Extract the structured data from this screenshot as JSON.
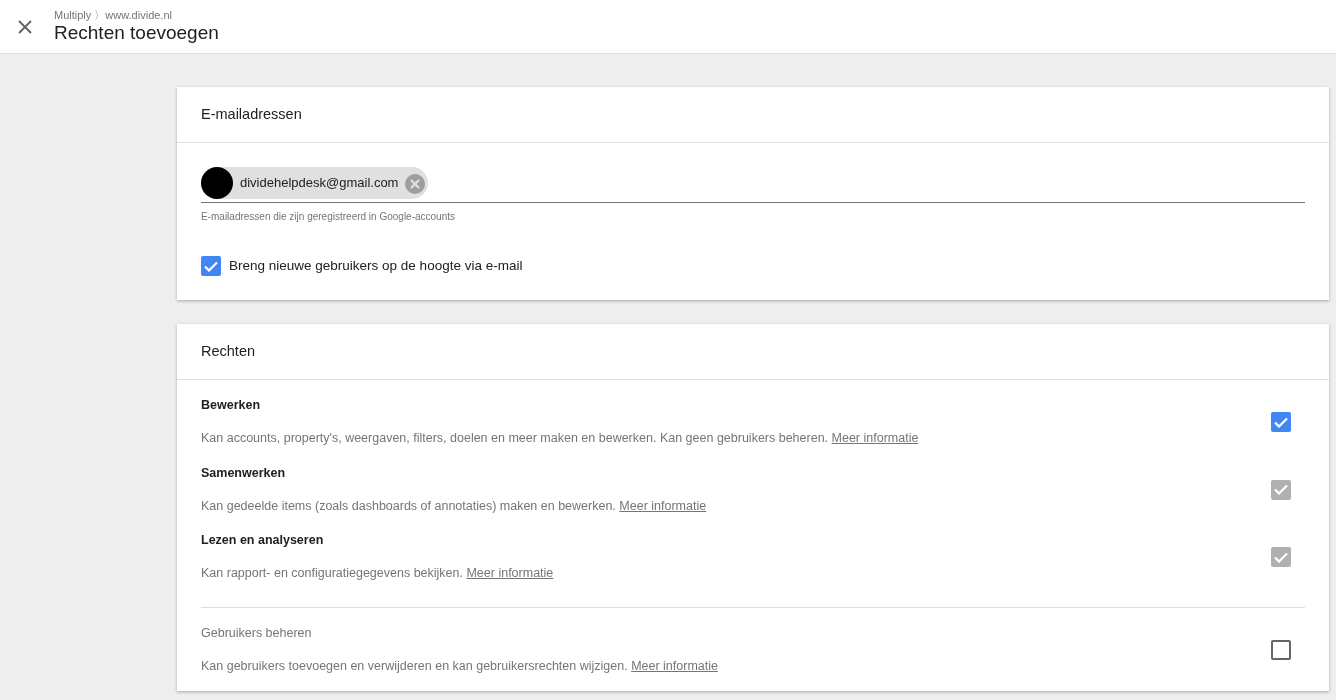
{
  "header": {
    "breadcrumb": "Multiply 〉www.divide.nl",
    "title": "Rechten toevoegen"
  },
  "emails": {
    "title": "E-mailadressen",
    "chips": [
      {
        "label": "dividehelpdesk@gmail.com"
      }
    ],
    "hint": "E-mailadressen die zijn geregistreerd in Google-accounts",
    "notify": {
      "label": "Breng nieuwe gebruikers op de hoogte via e-mail",
      "checked": true
    }
  },
  "rights": {
    "title": "Rechten",
    "items": [
      {
        "kind": "role",
        "title": "Bewerken",
        "description": "Kan accounts, property's, weergaven, filters, doelen en meer maken en bewerken. Kan geen gebruikers beheren.",
        "link": "Meer informatie",
        "checked": true,
        "disabled": false
      },
      {
        "kind": "role",
        "title": "Samenwerken",
        "description": "Kan gedeelde items (zoals dashboards of annotaties) maken en bewerken.",
        "link": "Meer informatie",
        "checked": true,
        "disabled": true
      },
      {
        "kind": "role",
        "title": "Lezen en analyseren",
        "description": "Kan rapport- en configuratiegegevens bekijken.",
        "link": "Meer informatie",
        "checked": true,
        "disabled": true
      },
      {
        "kind": "extra",
        "title": "Gebruikers beheren",
        "description": "Kan gebruikers toevoegen en verwijderen en kan gebruikersrechten wijzigen.",
        "link": "Meer informatie",
        "checked": false,
        "disabled": false
      }
    ]
  }
}
